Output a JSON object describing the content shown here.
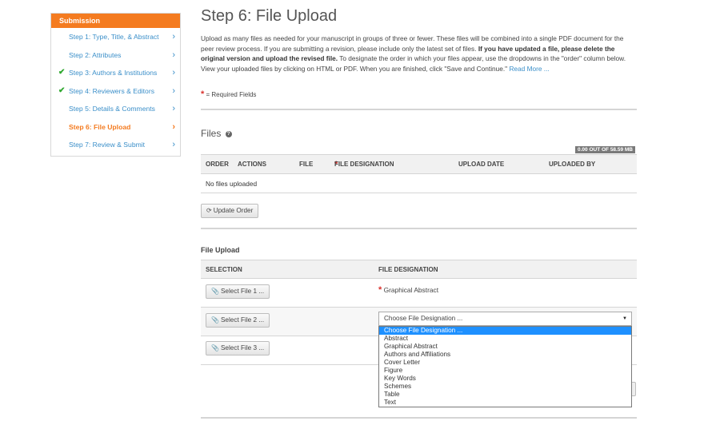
{
  "sidebar": {
    "header": "Submission",
    "steps": [
      {
        "label": "Step 1: Type, Title, & Abstract",
        "done": false
      },
      {
        "label": "Step 2: Attributes",
        "done": false
      },
      {
        "label": "Step 3: Authors & Institutions",
        "done": true
      },
      {
        "label": "Step 4: Reviewers & Editors",
        "done": true
      },
      {
        "label": "Step 5: Details & Comments",
        "done": false
      },
      {
        "label": "Step 6: File Upload",
        "done": false,
        "active": true
      },
      {
        "label": "Step 7: Review & Submit",
        "done": false
      }
    ]
  },
  "page": {
    "title": "Step 6: File Upload",
    "intro_1": "Upload as many files as needed for your manuscript in groups of three or fewer. These files will be combined into a single PDF document for the peer review process. If you are submitting a revision, please include only the latest set of files. ",
    "intro_bold": "If you have updated a file, please delete the original version and upload the revised file.",
    "intro_2": " To designate the order in which your files appear, use the dropdowns in the \"order\" column below. View your uploaded files by clicking on HTML or PDF. When you are finished, click \"Save and Continue.\" ",
    "read_more": "Read More ...",
    "required_star": "*",
    "required_text": " = Required Fields"
  },
  "files": {
    "title": "Files",
    "quota": "0.00 OUT OF 58.59 MB",
    "columns": {
      "order": "ORDER",
      "actions": "ACTIONS",
      "file": "FILE",
      "designation": "FILE DESIGNATION",
      "upload_date": "UPLOAD DATE",
      "uploaded_by": "UPLOADED BY"
    },
    "empty": "No files uploaded",
    "update_order": "Update Order"
  },
  "upload": {
    "title": "File Upload",
    "col_selection": "SELECTION",
    "col_designation": "FILE DESIGNATION",
    "rows": [
      {
        "button": "Select File 1 ...",
        "designation": "Graphical Abstract"
      },
      {
        "button": "Select File 2 ...",
        "select_value": "Choose File Designation ..."
      },
      {
        "button": "Select File 3 ..."
      }
    ]
  },
  "dropdown": {
    "options": [
      "Choose File Designation ...",
      "Abstract",
      "Graphical Abstract",
      "Authors and Affiliations",
      "Cover Letter",
      "Figure",
      "Key Words",
      "Schemes",
      "Table",
      "Text"
    ],
    "selected": "Choose File Designation ..."
  },
  "icons": {
    "check": "check-icon",
    "chevron": "chevron-right-icon",
    "help": "help-circle-icon",
    "refresh": "refresh-icon",
    "paperclip": "paperclip-icon"
  },
  "colors": {
    "accent": "#f47b20",
    "link": "#3b8fc9",
    "check": "#2fa82f",
    "required": "#d9302c",
    "highlight": "#1e90ff"
  }
}
